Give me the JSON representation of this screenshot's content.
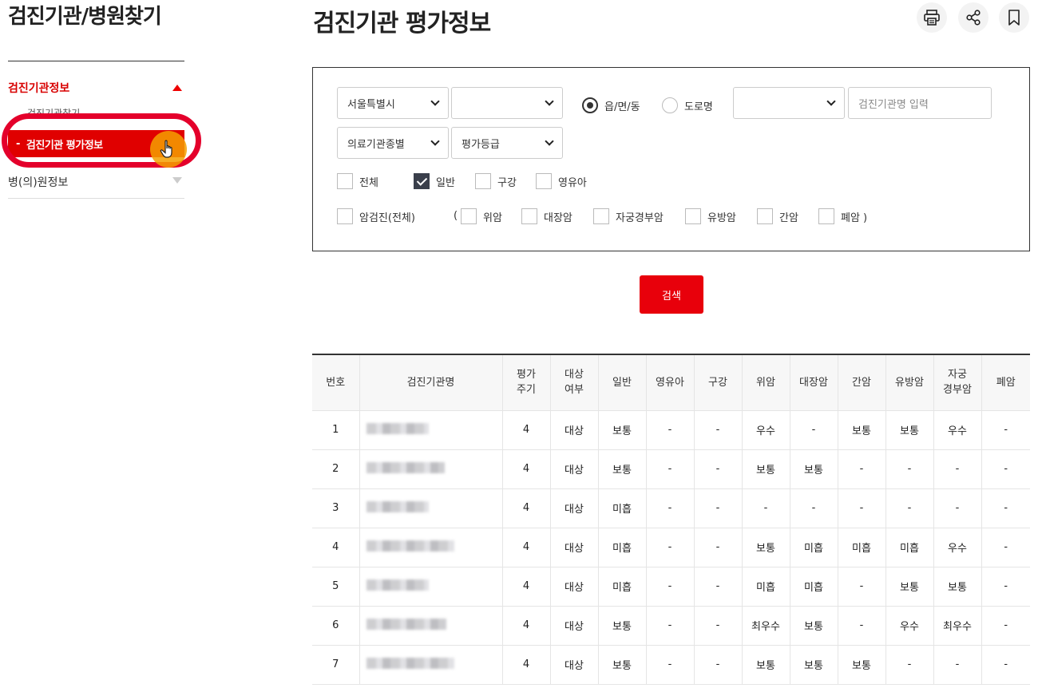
{
  "sidebar": {
    "title": "검진기관/병원찾기",
    "category_active": "검진기관정보",
    "sub_hidden": "검진기관찾기",
    "sub_active": "검진기관 평가정보",
    "sub_dash": "-",
    "category_second": "병(의)원정보"
  },
  "header": {
    "title": "검진기관 평가정보",
    "icons": [
      "print-icon",
      "share-icon",
      "bookmark-icon"
    ]
  },
  "search": {
    "city": "서울특별시",
    "district": "",
    "radio_town": "읍/면/동",
    "radio_road": "도로명",
    "town_select": "",
    "name_placeholder": "검진기관명 입력",
    "type_select": "의료기관종별",
    "grade_select": "평가등급",
    "checks": {
      "all": "전체",
      "general": "일반",
      "oral": "구강",
      "infant": "영유아",
      "cancer_all": "암검진(전체)",
      "paren_open": "(",
      "stomach": "위암",
      "colon": "대장암",
      "cervical": "자궁경부암",
      "breast": "유방암",
      "liver": "간암",
      "lung": "폐암 )"
    },
    "button": "검색"
  },
  "table": {
    "headers": {
      "no": "번호",
      "name": "검진기관명",
      "cycle_1": "평가",
      "cycle_2": "주기",
      "target_1": "대상",
      "target_2": "여부",
      "general": "일반",
      "infant": "영유아",
      "oral": "구강",
      "stomach": "위암",
      "colon": "대장암",
      "liver": "간암",
      "breast": "유방암",
      "cervical_1": "자궁",
      "cervical_2": "경부암",
      "lung": "폐암"
    },
    "rows": [
      [
        "1",
        "4",
        "대상",
        "보통",
        "-",
        "-",
        "우수",
        "-",
        "보통",
        "보통",
        "우수",
        "-"
      ],
      [
        "2",
        "4",
        "대상",
        "보통",
        "-",
        "-",
        "보통",
        "보통",
        "-",
        "-",
        "-",
        "-"
      ],
      [
        "3",
        "4",
        "대상",
        "미흡",
        "-",
        "-",
        "-",
        "-",
        "-",
        "-",
        "-",
        "-"
      ],
      [
        "4",
        "4",
        "대상",
        "미흡",
        "-",
        "-",
        "보통",
        "미흡",
        "미흡",
        "미흡",
        "우수",
        "-"
      ],
      [
        "5",
        "4",
        "대상",
        "미흡",
        "-",
        "-",
        "미흡",
        "미흡",
        "-",
        "보통",
        "보통",
        "-"
      ],
      [
        "6",
        "4",
        "대상",
        "보통",
        "-",
        "-",
        "최우수",
        "보통",
        "-",
        "우수",
        "최우수",
        "-"
      ],
      [
        "7",
        "4",
        "대상",
        "보통",
        "-",
        "-",
        "보통",
        "보통",
        "보통",
        "-",
        "-",
        "-"
      ]
    ]
  }
}
